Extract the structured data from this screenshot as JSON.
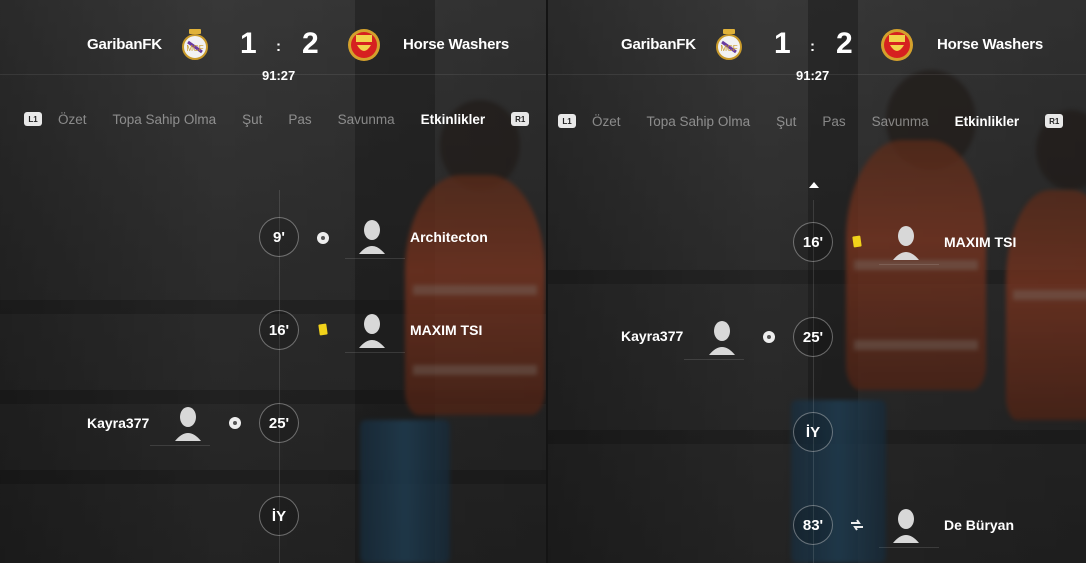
{
  "header": {
    "home_team": "GaribanFK",
    "home_score": "1",
    "separator": ":",
    "away_score": "2",
    "away_team": "Horse Washers",
    "clock": "91:27",
    "home_crest_icon": "real-madrid-crest-icon",
    "away_crest_icon": "manchester-united-crest-icon"
  },
  "tabs": {
    "left_bumper": "L1",
    "right_bumper": "R1",
    "items": [
      "Özet",
      "Topa Sahip Olma",
      "Şut",
      "Pas",
      "Savunma",
      "Etkinlikler"
    ],
    "active": "Etkinlikler"
  },
  "left_panel": {
    "events": [
      {
        "minute": "9'",
        "side": "away",
        "type": "goal",
        "icon": "ball-icon",
        "player": "Architecton"
      },
      {
        "minute": "16'",
        "side": "away",
        "type": "yellow-card",
        "icon": "yellow-card-icon",
        "player": "MAXIM TSI"
      },
      {
        "minute": "25'",
        "side": "home",
        "type": "goal",
        "icon": "ball-icon",
        "player": "Kayra377"
      },
      {
        "minute": "İY",
        "side": "none",
        "type": "half-time"
      }
    ]
  },
  "right_panel": {
    "events": [
      {
        "minute": "16'",
        "side": "away",
        "type": "yellow-card",
        "icon": "yellow-card-icon",
        "player": "MAXIM TSI"
      },
      {
        "minute": "25'",
        "side": "home",
        "type": "goal",
        "icon": "ball-icon",
        "player": "Kayra377"
      },
      {
        "minute": "İY",
        "side": "none",
        "type": "half-time"
      },
      {
        "minute": "83'",
        "side": "away",
        "type": "substitution",
        "icon": "substitution-icon",
        "player": "De Büryan"
      }
    ]
  },
  "colors": {
    "yellow_card": "#f1d21a",
    "active_tab": "#ffffff",
    "inactive_tab": "#8a8a8a"
  }
}
